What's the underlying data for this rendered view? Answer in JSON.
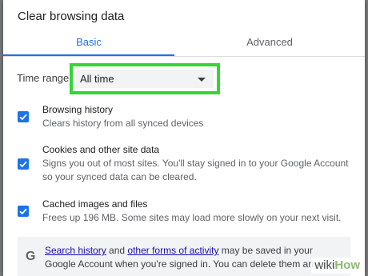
{
  "dialog": {
    "title": "Clear browsing data"
  },
  "tabs": [
    {
      "label": "Basic",
      "active": true
    },
    {
      "label": "Advanced",
      "active": false
    }
  ],
  "time_range": {
    "label": "Time range",
    "value": "All time"
  },
  "options": [
    {
      "title": "Browsing history",
      "description": "Clears history from all synced devices",
      "checked": true
    },
    {
      "title": "Cookies and other site data",
      "description": "Signs you out of most sites. You'll stay signed in to your Google Account so your synced data can be cleared.",
      "checked": true
    },
    {
      "title": "Cached images and files",
      "description": "Frees up 196 MB. Some sites may load more slowly on your next visit.",
      "checked": true
    }
  ],
  "info": {
    "icon": "G",
    "link1": "Search history",
    "text1": " and ",
    "link2": "other forms of activity",
    "text2": " may be saved in your Google Account when you're signed in. You can delete them anytime."
  },
  "watermark": {
    "wiki": "wiki",
    "how": "How"
  },
  "colors": {
    "accent": "#1a73e8",
    "highlight": "#33d633"
  }
}
